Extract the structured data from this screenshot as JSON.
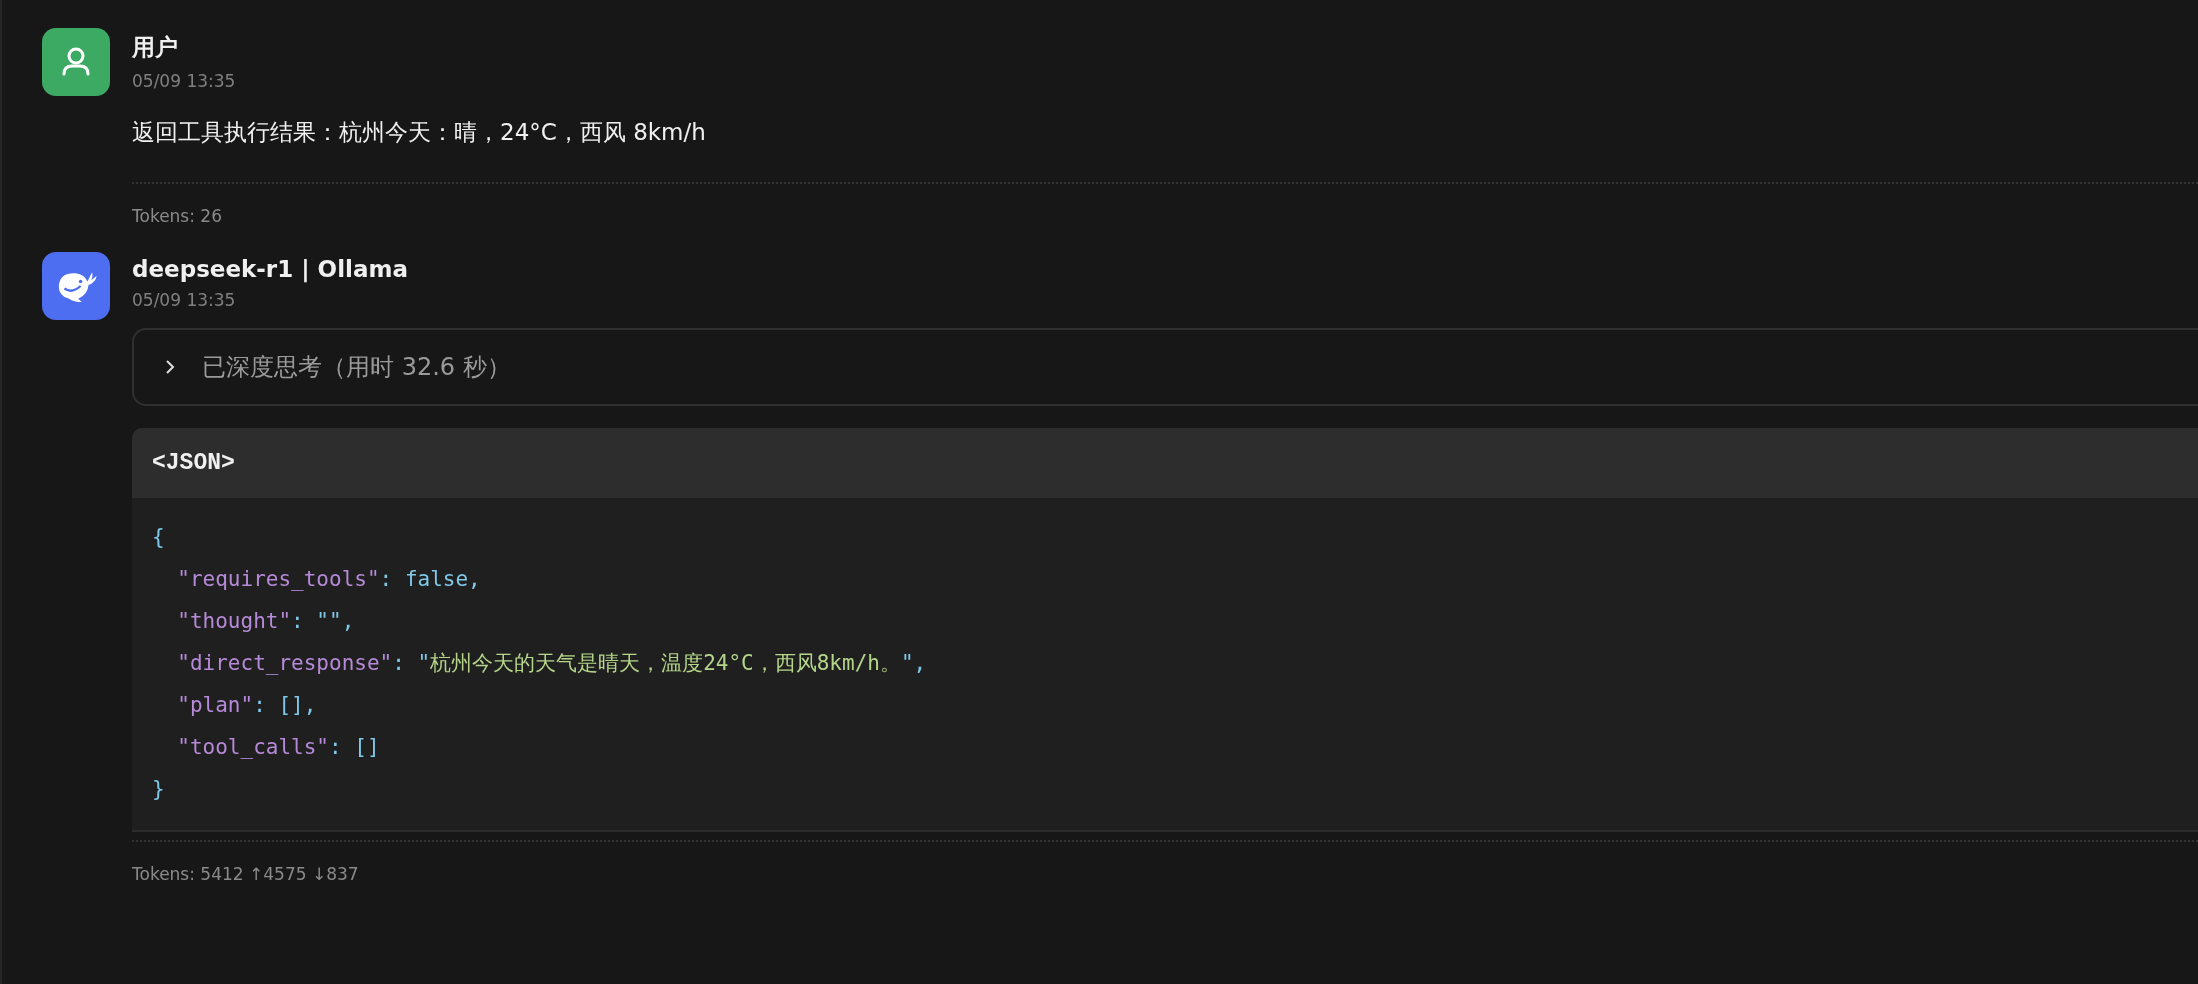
{
  "messages": [
    {
      "kind": "user",
      "author": "用户",
      "time": "05/09 13:35",
      "text": "返回工具执行结果：杭州今天：晴，24°C，西风 8km/h",
      "tokens": "Tokens: 26"
    },
    {
      "kind": "assistant",
      "author": "deepseek-r1 | Ollama",
      "time": "05/09 13:35",
      "thinking": {
        "label": "已深度思考（用时 32.6 秒）",
        "expanded": false
      },
      "code": {
        "language": "<JSON>",
        "lines": [
          [
            {
              "kind": "punct",
              "text": "{"
            }
          ],
          [
            {
              "kind": "key",
              "text": "  \"requires_tools\""
            },
            {
              "kind": "punct",
              "text": ": "
            },
            {
              "kind": "literal",
              "text": "false"
            },
            {
              "kind": "punct",
              "text": ","
            }
          ],
          [
            {
              "kind": "key",
              "text": "  \"thought\""
            },
            {
              "kind": "punct",
              "text": ": \"\","
            }
          ],
          [
            {
              "kind": "key",
              "text": "  \"direct_response\""
            },
            {
              "kind": "punct",
              "text": ": \""
            },
            {
              "kind": "string",
              "text": "杭州今天的天气是晴天，温度24°C，西风8km/h。"
            },
            {
              "kind": "punct",
              "text": "\","
            }
          ],
          [
            {
              "kind": "key",
              "text": "  \"plan\""
            },
            {
              "kind": "punct",
              "text": ": [],"
            }
          ],
          [
            {
              "kind": "key",
              "text": "  \"tool_calls\""
            },
            {
              "kind": "punct",
              "text": ": []"
            }
          ],
          [
            {
              "kind": "punct",
              "text": "}"
            }
          ]
        ]
      },
      "tokens": "Tokens: 5412 ↑4575 ↓837"
    }
  ]
}
